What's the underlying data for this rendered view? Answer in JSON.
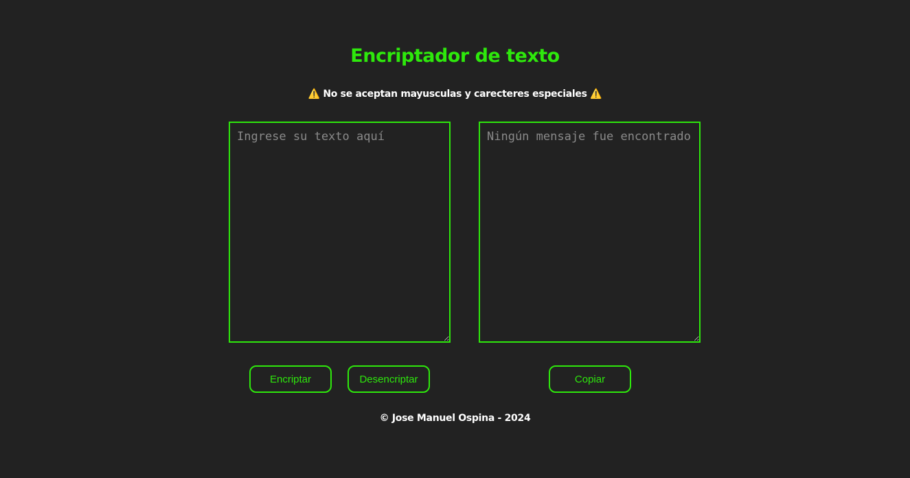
{
  "page": {
    "title": "Encriptador de texto",
    "warning": "⚠️ No se aceptan mayusculas y carecteres especiales ⚠️"
  },
  "input": {
    "placeholder": "Ingrese su texto aquí",
    "value": ""
  },
  "output": {
    "placeholder": "Ningún mensaje fue encontrado",
    "value": ""
  },
  "buttons": {
    "encrypt_label": "Encriptar",
    "decrypt_label": "Desencriptar",
    "copy_label": "Copiar"
  },
  "footer": {
    "text": "© Jose Manuel Ospina - 2024"
  },
  "colors": {
    "background": "#222222",
    "accent": "#2ee80c",
    "text": "#ffffff"
  }
}
